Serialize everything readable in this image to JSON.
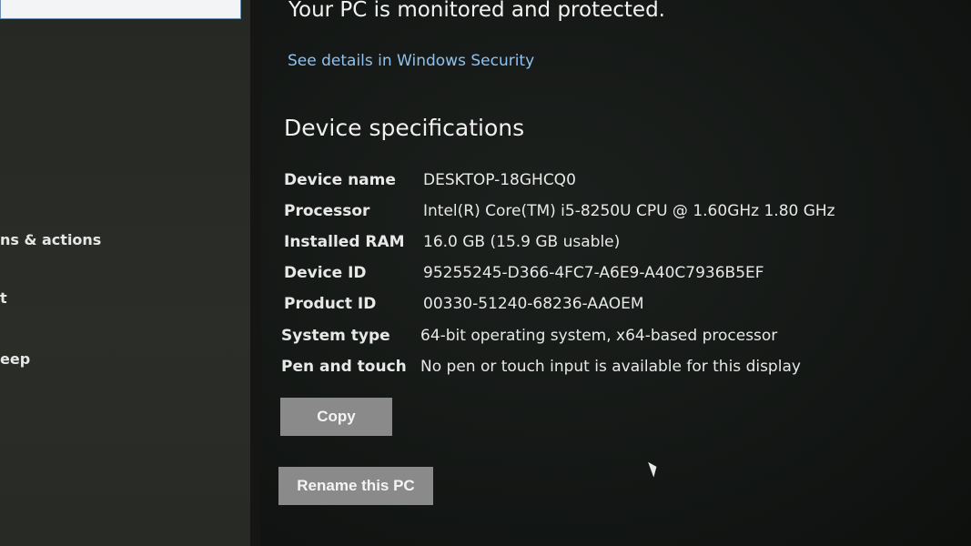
{
  "sidebar": {
    "items": [
      {
        "label": "ns & actions"
      },
      {
        "label": "t"
      },
      {
        "label": "eep"
      }
    ]
  },
  "main": {
    "status_text": "Your PC is monitored and protected.",
    "security_link": "See details in Windows Security",
    "section_title": "Device specifications",
    "specs": [
      {
        "key": "Device name",
        "value": "DESKTOP-18GHCQ0"
      },
      {
        "key": "Processor",
        "value": "Intel(R) Core(TM) i5-8250U CPU @ 1.60GHz   1.80 GHz"
      },
      {
        "key": "Installed RAM",
        "value": "16.0 GB (15.9 GB usable)"
      },
      {
        "key": "Device ID",
        "value": "95255245-D366-4FC7-A6E9-A40C7936B5EF"
      },
      {
        "key": "Product ID",
        "value": "00330-51240-68236-AAOEM"
      },
      {
        "key": "System type",
        "value": "64-bit operating system, x64-based processor"
      },
      {
        "key": "Pen and touch",
        "value": "No pen or touch input is available for this display"
      }
    ],
    "copy_label": "Copy",
    "rename_label": "Rename this PC"
  },
  "colors": {
    "link": "#8fc2ef",
    "button": "#8a8a8a"
  }
}
